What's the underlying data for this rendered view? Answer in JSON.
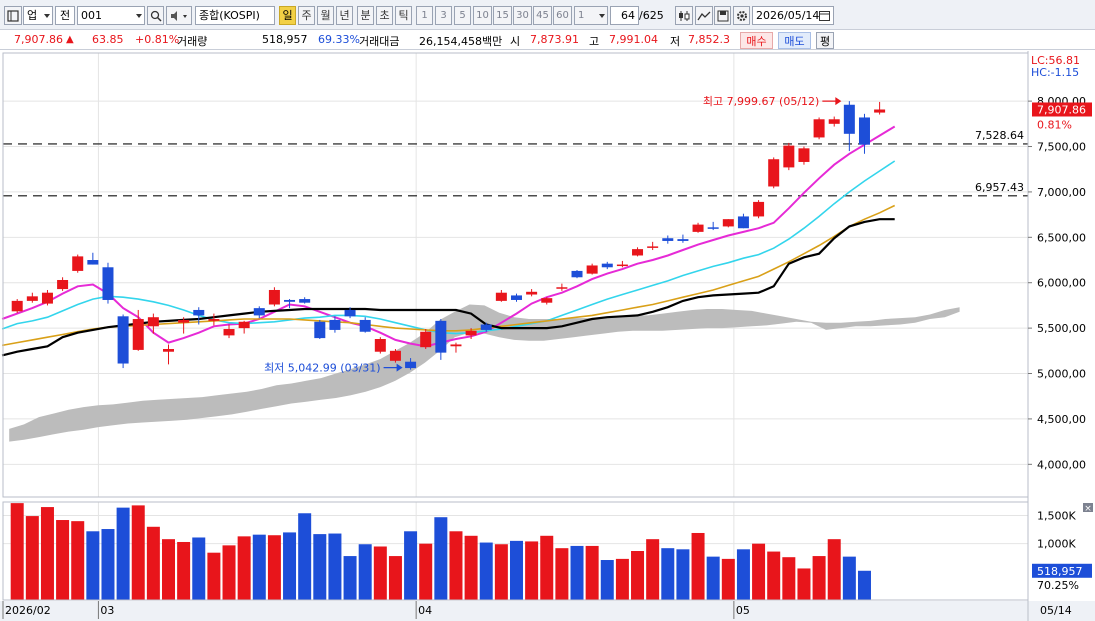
{
  "toolbar": {
    "market_select": "업",
    "prev_label": "전",
    "code": "001",
    "name": "종합(KOSPI)",
    "periods": [
      "일",
      "주",
      "월",
      "년",
      "분",
      "초",
      "틱"
    ],
    "selected_period": "일",
    "intervals": [
      "1",
      "3",
      "5",
      "10",
      "15",
      "30",
      "45",
      "60"
    ],
    "interval_value": "1",
    "count": "64",
    "count_total": "/625",
    "date": "2026/05/14"
  },
  "quote": {
    "price": "7,907.86",
    "arrow": "▲",
    "change": "63.85",
    "change_pct": "+0.81%",
    "volume_label": "거래량",
    "volume": "518,957",
    "volume_ratio": "69.33%",
    "amount_label": "거래대금",
    "amount": "26,154,458백만",
    "open_label": "시",
    "open": "7,873.91",
    "high_label": "고",
    "high": "7,991.04",
    "low_label": "저",
    "low": "7,852.3",
    "buy_button": "매수",
    "sell_button": "매도",
    "eval_button": "평"
  },
  "colors": {
    "up": "#e8151b",
    "down": "#1d4ed8",
    "ma5": "#e62ad6",
    "ma20": "#33d5ec",
    "ma60": "#d9a018",
    "ma120": "#000000",
    "cloud": "#bcbcbc",
    "current_tag": "#e8151b",
    "volume_tag": "#1d4ed8"
  },
  "chart_data": {
    "type": "candlestick",
    "price_axis": {
      "ticks": [
        4000,
        4500,
        5000,
        5500,
        6000,
        6500,
        7000,
        7500,
        8000
      ],
      "tick_labels": [
        "4,000,00",
        "4,500,00",
        "5,000,00",
        "5,500,00",
        "6,000,00",
        "6,500,00",
        "7,000,00",
        "7,500,00",
        "8,000,00"
      ],
      "range": [
        3640,
        8530
      ]
    },
    "volume_axis": {
      "ticks": [
        1000,
        1500
      ],
      "tick_labels": [
        "1,000K",
        "1,500K"
      ],
      "range": [
        0,
        1740
      ]
    },
    "legend": {
      "lc": "LC:56.81",
      "hc": "HC:-1.15"
    },
    "current": {
      "price_label": "7,907.86",
      "price_value": 7907.86,
      "pct": "0.81%",
      "volume_label": "518,957",
      "volume_value": 518957,
      "volume_pct": "70.25%"
    },
    "annotations": {
      "high_text": "최고 7,999.67 (05/12)",
      "high_value": 7999.67,
      "low_text": "최저 5,042.99 (03/31)",
      "low_value": 5042.99
    },
    "hlines": [
      {
        "value": 7528.64,
        "label": "7,528.64"
      },
      {
        "value": 6957.43,
        "label": "6,957.43"
      }
    ],
    "x_labels": [
      {
        "label": "2026/02",
        "index": 0
      },
      {
        "label": "03",
        "index": 6
      },
      {
        "label": "04",
        "index": 27
      },
      {
        "label": "05",
        "index": 48
      }
    ],
    "last_date": "05/14",
    "candles": [
      {
        "o": 5685,
        "h": 5820,
        "l": 5665,
        "c": 5800
      },
      {
        "o": 5800,
        "h": 5890,
        "l": 5780,
        "c": 5850
      },
      {
        "o": 5770,
        "h": 5920,
        "l": 5750,
        "c": 5890
      },
      {
        "o": 5930,
        "h": 6060,
        "l": 5910,
        "c": 6030
      },
      {
        "o": 6130,
        "h": 6310,
        "l": 6110,
        "c": 6290
      },
      {
        "o": 6250,
        "h": 6330,
        "l": 6200,
        "c": 6200
      },
      {
        "o": 6170,
        "h": 6220,
        "l": 5770,
        "c": 5810
      },
      {
        "o": 5630,
        "h": 5650,
        "l": 5060,
        "c": 5110
      },
      {
        "o": 5260,
        "h": 5700,
        "l": 5250,
        "c": 5600
      },
      {
        "o": 5520,
        "h": 5660,
        "l": 5440,
        "c": 5620
      },
      {
        "o": 5240,
        "h": 5320,
        "l": 5100,
        "c": 5270
      },
      {
        "o": 5560,
        "h": 5620,
        "l": 5440,
        "c": 5590
      },
      {
        "o": 5700,
        "h": 5730,
        "l": 5540,
        "c": 5640
      },
      {
        "o": 5580,
        "h": 5660,
        "l": 5530,
        "c": 5600
      },
      {
        "o": 5420,
        "h": 5540,
        "l": 5390,
        "c": 5490
      },
      {
        "o": 5500,
        "h": 5580,
        "l": 5440,
        "c": 5570
      },
      {
        "o": 5720,
        "h": 5740,
        "l": 5610,
        "c": 5640
      },
      {
        "o": 5760,
        "h": 5950,
        "l": 5740,
        "c": 5920
      },
      {
        "o": 5810,
        "h": 5820,
        "l": 5720,
        "c": 5790
      },
      {
        "o": 5820,
        "h": 5840,
        "l": 5770,
        "c": 5780
      },
      {
        "o": 5570,
        "h": 5590,
        "l": 5380,
        "c": 5390
      },
      {
        "o": 5590,
        "h": 5630,
        "l": 5450,
        "c": 5480
      },
      {
        "o": 5700,
        "h": 5730,
        "l": 5610,
        "c": 5630
      },
      {
        "o": 5590,
        "h": 5620,
        "l": 5450,
        "c": 5460
      },
      {
        "o": 5240,
        "h": 5400,
        "l": 5220,
        "c": 5380
      },
      {
        "o": 5140,
        "h": 5270,
        "l": 5120,
        "c": 5250
      },
      {
        "o": 5130,
        "h": 5170,
        "l": 5042.99,
        "c": 5060
      },
      {
        "o": 5290,
        "h": 5490,
        "l": 5270,
        "c": 5460
      },
      {
        "o": 5580,
        "h": 5600,
        "l": 5150,
        "c": 5230
      },
      {
        "o": 5300,
        "h": 5340,
        "l": 5230,
        "c": 5320
      },
      {
        "o": 5420,
        "h": 5500,
        "l": 5380,
        "c": 5470
      },
      {
        "o": 5540,
        "h": 5560,
        "l": 5460,
        "c": 5480
      },
      {
        "o": 5800,
        "h": 5920,
        "l": 5790,
        "c": 5890
      },
      {
        "o": 5860,
        "h": 5880,
        "l": 5790,
        "c": 5810
      },
      {
        "o": 5870,
        "h": 5930,
        "l": 5850,
        "c": 5900
      },
      {
        "o": 5780,
        "h": 5840,
        "l": 5760,
        "c": 5830
      },
      {
        "o": 5940,
        "h": 5990,
        "l": 5910,
        "c": 5950
      },
      {
        "o": 6130,
        "h": 6140,
        "l": 6050,
        "c": 6060
      },
      {
        "o": 6100,
        "h": 6210,
        "l": 6090,
        "c": 6190
      },
      {
        "o": 6210,
        "h": 6230,
        "l": 6150,
        "c": 6170
      },
      {
        "o": 6190,
        "h": 6240,
        "l": 6170,
        "c": 6200
      },
      {
        "o": 6300,
        "h": 6390,
        "l": 6290,
        "c": 6370
      },
      {
        "o": 6390,
        "h": 6450,
        "l": 6360,
        "c": 6400
      },
      {
        "o": 6490,
        "h": 6520,
        "l": 6430,
        "c": 6460
      },
      {
        "o": 6480,
        "h": 6530,
        "l": 6440,
        "c": 6460
      },
      {
        "o": 6560,
        "h": 6660,
        "l": 6550,
        "c": 6640
      },
      {
        "o": 6610,
        "h": 6670,
        "l": 6580,
        "c": 6600
      },
      {
        "o": 6620,
        "h": 6700,
        "l": 6610,
        "c": 6700
      },
      {
        "o": 6730,
        "h": 6760,
        "l": 6600,
        "c": 6600
      },
      {
        "o": 6730,
        "h": 6910,
        "l": 6710,
        "c": 6890
      },
      {
        "o": 7060,
        "h": 7380,
        "l": 7040,
        "c": 7360
      },
      {
        "o": 7270,
        "h": 7540,
        "l": 7240,
        "c": 7510
      },
      {
        "o": 7330,
        "h": 7500,
        "l": 7300,
        "c": 7480
      },
      {
        "o": 7600,
        "h": 7820,
        "l": 7580,
        "c": 7800
      },
      {
        "o": 7750,
        "h": 7830,
        "l": 7720,
        "c": 7800
      },
      {
        "o": 7960,
        "h": 7999.67,
        "l": 7450,
        "c": 7640
      },
      {
        "o": 7820,
        "h": 7860,
        "l": 7420,
        "c": 7520
      },
      {
        "o": 7873.91,
        "h": 7991.04,
        "l": 7852.3,
        "c": 7907.86
      }
    ],
    "volumes": [
      1720,
      1490,
      1650,
      1420,
      1400,
      1220,
      1260,
      1640,
      1680,
      1300,
      1080,
      1030,
      1110,
      840,
      970,
      1130,
      1160,
      1150,
      1200,
      1540,
      1170,
      1180,
      780,
      990,
      950,
      780,
      1220,
      1000,
      1470,
      1220,
      1140,
      1020,
      990,
      1050,
      1040,
      1140,
      920,
      960,
      960,
      710,
      730,
      870,
      1080,
      920,
      900,
      1190,
      770,
      730,
      900,
      1000,
      860,
      760,
      560,
      780,
      1080,
      770,
      518.957
    ],
    "series": [
      {
        "name": "MA5",
        "values": [
          5600,
          5660,
          5720,
          5790,
          5880,
          5960,
          5980,
          5880,
          5720,
          5620,
          5450,
          5340,
          5390,
          5450,
          5520,
          5540,
          5550,
          5600,
          5680,
          5760,
          5740,
          5680,
          5620,
          5560,
          5520,
          5450,
          5370,
          5330,
          5300,
          5340,
          5380,
          5410,
          5460,
          5560,
          5660,
          5770,
          5840,
          5890,
          5960,
          6040,
          6100,
          6150,
          6210,
          6250,
          6300,
          6360,
          6420,
          6470,
          6520,
          6560,
          6600,
          6660,
          6820,
          6990,
          7150,
          7300,
          7420,
          7520,
          7620,
          7720
        ]
      },
      {
        "name": "MA20",
        "values": [
          5490,
          5550,
          5580,
          5620,
          5690,
          5760,
          5820,
          5850,
          5840,
          5820,
          5790,
          5750,
          5700,
          5640,
          5590,
          5560,
          5550,
          5560,
          5570,
          5590,
          5610,
          5620,
          5640,
          5640,
          5630,
          5600,
          5560,
          5520,
          5480,
          5450,
          5440,
          5450,
          5470,
          5490,
          5520,
          5550,
          5580,
          5640,
          5700,
          5760,
          5820,
          5870,
          5920,
          5970,
          6020,
          6080,
          6130,
          6180,
          6220,
          6270,
          6310,
          6380,
          6480,
          6600,
          6730,
          6870,
          7000,
          7120,
          7230,
          7340
        ]
      },
      {
        "name": "MA60",
        "values": [
          5310,
          5340,
          5370,
          5400,
          5430,
          5460,
          5490,
          5510,
          5520,
          5530,
          5540,
          5550,
          5560,
          5570,
          5580,
          5590,
          5600,
          5600,
          5600,
          5600,
          5590,
          5580,
          5570,
          5560,
          5540,
          5520,
          5500,
          5490,
          5480,
          5470,
          5470,
          5480,
          5500,
          5520,
          5540,
          5560,
          5580,
          5600,
          5620,
          5640,
          5670,
          5700,
          5730,
          5760,
          5800,
          5840,
          5880,
          5920,
          5970,
          6020,
          6070,
          6150,
          6230,
          6320,
          6410,
          6510,
          6620,
          6700,
          6770,
          6850
        ]
      },
      {
        "name": "MA120",
        "values": [
          5200,
          5240,
          5270,
          5300,
          5400,
          5450,
          5480,
          5510,
          5530,
          5550,
          5570,
          5580,
          5590,
          5600,
          5620,
          5640,
          5660,
          5680,
          5690,
          5700,
          5710,
          5710,
          5710,
          5710,
          5710,
          5700,
          5700,
          5700,
          5700,
          5700,
          5700,
          5660,
          5540,
          5500,
          5500,
          5500,
          5500,
          5520,
          5560,
          5600,
          5620,
          5630,
          5640,
          5680,
          5730,
          5800,
          5840,
          5860,
          5870,
          5880,
          5890,
          5960,
          6210,
          6280,
          6320,
          6490,
          6620,
          6670,
          6700,
          6700
        ]
      }
    ],
    "cloud_upper": [
      4390,
      4440,
      4520,
      4560,
      4600,
      4630,
      4650,
      4660,
      4680,
      4700,
      4710,
      4720,
      4730,
      4740,
      4760,
      4780,
      4800,
      4830,
      4870,
      4890,
      4920,
      4950,
      5000,
      5050,
      5100,
      5160,
      5250,
      5340,
      5450,
      5590,
      5680,
      5760,
      5750,
      5670,
      5620,
      5600,
      5600,
      5600,
      5610,
      5610,
      5620,
      5630,
      5640,
      5640,
      5660,
      5680,
      5700,
      5710,
      5710,
      5700,
      5690,
      5660,
      5630,
      5600,
      5570,
      5560,
      5560,
      5570,
      5580,
      5600,
      5610,
      5620,
      5650,
      5700,
      5730
    ],
    "cloud_lower": [
      4250,
      4270,
      4300,
      4330,
      4360,
      4380,
      4410,
      4430,
      4450,
      4460,
      4470,
      4480,
      4490,
      4510,
      4530,
      4550,
      4580,
      4610,
      4640,
      4670,
      4690,
      4710,
      4730,
      4760,
      4800,
      4850,
      4920,
      5010,
      5120,
      5250,
      5400,
      5450,
      5440,
      5400,
      5370,
      5360,
      5360,
      5380,
      5400,
      5420,
      5440,
      5460,
      5470,
      5470,
      5470,
      5480,
      5490,
      5500,
      5500,
      5510,
      5520,
      5530,
      5550,
      5570,
      5560,
      5480,
      5500,
      5520,
      5520,
      5530,
      5540,
      5560,
      5600,
      5620,
      5680
    ]
  }
}
